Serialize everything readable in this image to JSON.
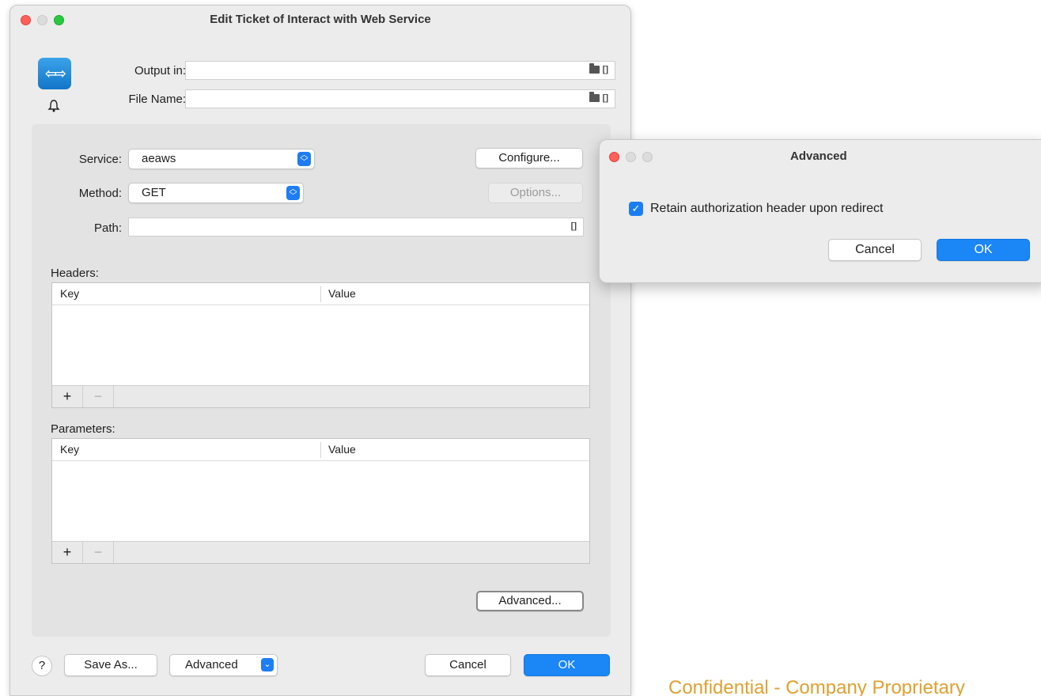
{
  "main_window": {
    "title": "Edit Ticket of Interact with Web Service",
    "output_in_label": "Output in:",
    "output_in_value": "",
    "file_name_label": "File Name:",
    "file_name_value": "",
    "bracket_glyph": "[]",
    "service_label": "Service:",
    "service_value": "aeaws",
    "method_label": "Method:",
    "method_value": "GET",
    "path_label": "Path:",
    "path_value": "",
    "configure_button": "Configure...",
    "options_button": "Options...",
    "headers": {
      "label": "Headers:",
      "columns": [
        "Key",
        "Value"
      ],
      "add": "+",
      "remove": "−"
    },
    "parameters": {
      "label": "Parameters:",
      "columns": [
        "Key",
        "Value"
      ],
      "add": "+",
      "remove": "−"
    },
    "advanced_button": "Advanced...",
    "help_button": "?",
    "save_as_button": "Save As...",
    "advanced_dropdown": "Advanced",
    "cancel_button": "Cancel",
    "ok_button": "OK"
  },
  "advanced_dialog": {
    "title": "Advanced",
    "checkbox_label": "Retain authorization header upon redirect",
    "checkbox_checked": true,
    "cancel_button": "Cancel",
    "ok_button": "OK"
  },
  "watermark": "Confidential - Company Proprietary",
  "colors": {
    "accent": "#1b86f5",
    "watermark": "#e0a030"
  }
}
